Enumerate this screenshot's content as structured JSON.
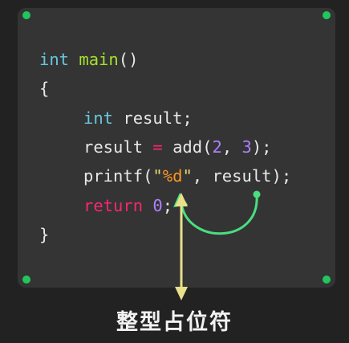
{
  "colors": {
    "background": "#222222",
    "panel": "#343434",
    "dot": "#22c55e",
    "type_keyword": "#67c7dd",
    "function": "#a6e22e",
    "control_keyword": "#f92672",
    "number": "#ae81ff",
    "string": "#e6db74",
    "format_specifier": "#fd971f",
    "plain": "#e8e8e8",
    "arrow_yellow": "#e8e08a",
    "arrow_green": "#4ade80"
  },
  "code": {
    "line1": {
      "type": "int",
      "name": "main",
      "parens": "()"
    },
    "line2": {
      "brace": "{"
    },
    "line3": {
      "type": "int",
      "rest": "result;"
    },
    "line4": {
      "var": "result",
      "op": "=",
      "func": "add",
      "open": "(",
      "arg1": "2",
      "sep": ", ",
      "arg2": "3",
      "close": ");"
    },
    "line5": {
      "func": "printf",
      "open": "(",
      "quote_open": "\"",
      "spec": "%d",
      "quote_close": "\"",
      "rest": ", result);"
    },
    "line6": {
      "keyword": "return",
      "value": "0",
      "end": ";"
    },
    "line7": {
      "brace": "}"
    }
  },
  "caption": "整型占位符"
}
